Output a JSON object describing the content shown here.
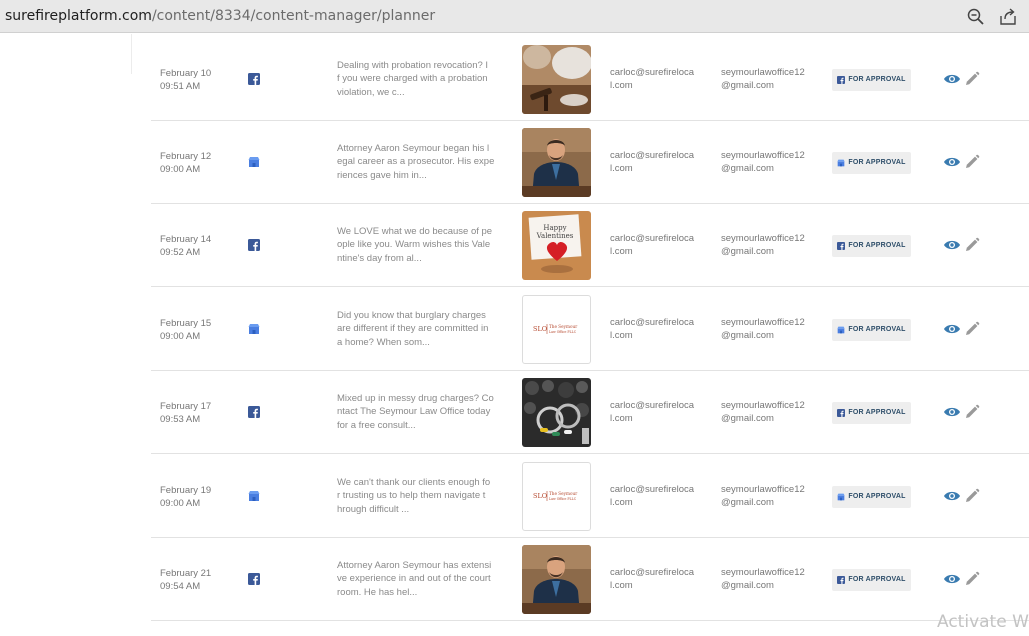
{
  "browser": {
    "url_host": "surefireplatform.com",
    "url_path": "/content/8334/content-manager/planner",
    "zoom_icon": "zoom-out-icon",
    "share_icon": "share-icon"
  },
  "rows": [
    {
      "date": "February 10",
      "time": "09:51 AM",
      "channel": "facebook",
      "caption": [
        "Dealing with probation revocation? I",
        "f you were charged with a probation",
        "violation, we c..."
      ],
      "image": "gavel-photo",
      "author": [
        "carloc@surefireloca",
        "l.com"
      ],
      "client": [
        "seymourlawoffice12",
        "@gmail.com"
      ],
      "status": "FOR APPROVAL"
    },
    {
      "date": "February 12",
      "time": "09:00 AM",
      "channel": "google-business",
      "caption": [
        "Attorney Aaron Seymour began his l",
        "egal career as a prosecutor. His expe",
        "riences gave him in..."
      ],
      "image": "attorney-portrait",
      "author": [
        "carloc@surefireloca",
        "l.com"
      ],
      "client": [
        "seymourlawoffice12",
        "@gmail.com"
      ],
      "status": "FOR APPROVAL"
    },
    {
      "date": "February 14",
      "time": "09:52 AM",
      "channel": "facebook",
      "caption": [
        "We LOVE what we do because of pe",
        "ople like you. Warm wishes this Vale",
        "ntine's day from al..."
      ],
      "image": "valentines-card",
      "image_text": [
        "Happy",
        "Valentines"
      ],
      "author": [
        "carloc@surefireloca",
        "l.com"
      ],
      "client": [
        "seymourlawoffice12",
        "@gmail.com"
      ],
      "status": "FOR APPROVAL"
    },
    {
      "date": "February 15",
      "time": "09:00 AM",
      "channel": "google-business",
      "caption": [
        "Did you know that burglary charges",
        "are different if they are committed in",
        "a home? When som..."
      ],
      "image": "firm-logo",
      "author": [
        "carloc@surefireloca",
        "l.com"
      ],
      "client": [
        "seymourlawoffice12",
        "@gmail.com"
      ],
      "status": "FOR APPROVAL"
    },
    {
      "date": "February 17",
      "time": "09:53 AM",
      "channel": "facebook",
      "caption": [
        "Mixed up in messy drug charges? Co",
        "ntact The Seymour Law Office today",
        "for a free consult..."
      ],
      "image": "handcuffs-pills",
      "author": [
        "carloc@surefireloca",
        "l.com"
      ],
      "client": [
        "seymourlawoffice12",
        "@gmail.com"
      ],
      "status": "FOR APPROVAL"
    },
    {
      "date": "February 19",
      "time": "09:00 AM",
      "channel": "google-business",
      "caption": [
        "We can't thank our clients enough fo",
        "r trusting us to help them navigate t",
        "hrough difficult ..."
      ],
      "image": "firm-logo",
      "author": [
        "carloc@surefireloca",
        "l.com"
      ],
      "client": [
        "seymourlawoffice12",
        "@gmail.com"
      ],
      "status": "FOR APPROVAL"
    },
    {
      "date": "February 21",
      "time": "09:54 AM",
      "channel": "facebook",
      "caption": [
        "Attorney Aaron Seymour has extensi",
        "ve experience in and out of the court",
        "room. He has hel..."
      ],
      "image": "attorney-portrait",
      "author": [
        "carloc@surefireloca",
        "l.com"
      ],
      "client": [
        "seymourlawoffice12",
        "@gmail.com"
      ],
      "status": "FOR APPROVAL"
    }
  ],
  "logo_text": {
    "mark": "SLO",
    "line1": "The Seymour",
    "line2": "Law Office PLLC"
  },
  "watermark": "Activate W",
  "colors": {
    "facebook": "#3b5998",
    "gmb": "#4a7ee0",
    "eye": "#3a7bb0",
    "pencil": "#9a9a9a",
    "status_bg": "#eeeeee"
  }
}
